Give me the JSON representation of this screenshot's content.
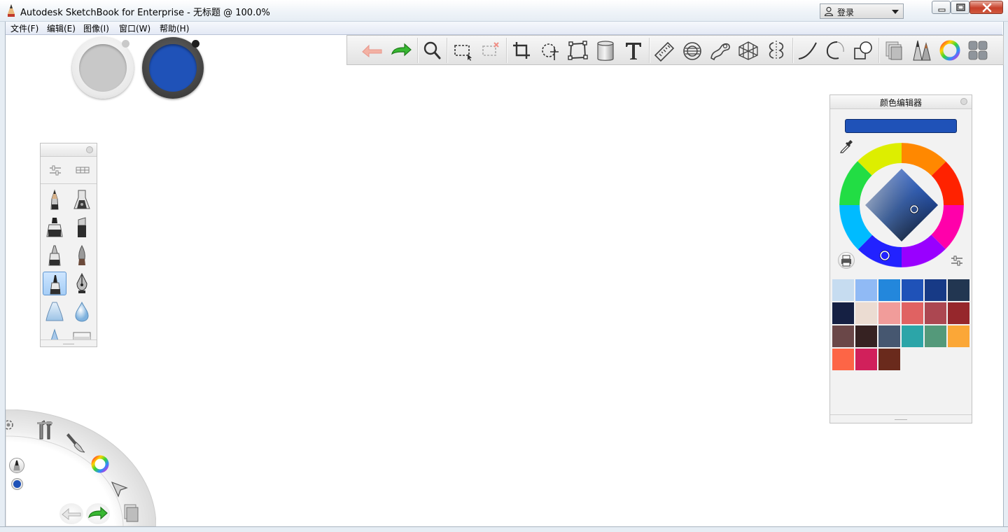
{
  "window": {
    "title": "Autodesk SketchBook for Enterprise - 无标题 @ 100.0%",
    "login_label": "登录"
  },
  "menu": [
    "文件(F)",
    "编辑(E)",
    "图像(I)",
    "窗口(W)",
    "帮助(H)"
  ],
  "colors": {
    "primary": "#1f52b8",
    "secondary": "#c8c8c8"
  },
  "toolbar": {
    "tools": [
      "undo-icon",
      "redo-icon",
      "zoom-icon",
      "select-rect-icon",
      "select-clear-icon",
      "crop-icon",
      "transform-lasso-icon",
      "distort-icon",
      "fill-bucket-icon",
      "text-icon",
      "ruler-icon",
      "ellipse-guide-icon",
      "french-curve-icon",
      "perspective-icon",
      "symmetry-icon",
      "stroke-line-icon",
      "ellipse-stroke-icon",
      "shape-icon",
      "layers-icon",
      "brush-library-icon",
      "color-wheel-icon",
      "tool-menu-icon"
    ]
  },
  "brush_panel": {
    "brushes": [
      "pencil",
      "airbrush",
      "marker",
      "chisel-marker",
      "ballpoint-pen",
      "paint-brush",
      "fine-pen",
      "ink-pen",
      "soft-eraser",
      "water-drop",
      "triangle-tip",
      "flat-eraser"
    ],
    "selected_index": 6
  },
  "color_editor": {
    "title": "颜色编辑器",
    "current_color": "#1f52b8",
    "swatches": [
      "#c6dcf0",
      "#90baf5",
      "#2387dc",
      "#1f52b8",
      "#173a86",
      "#223651",
      "#152043",
      "#ebdcd2",
      "#f19c9a",
      "#e06262",
      "#ac4751",
      "#96272c",
      "#6a4748",
      "#362222",
      "#465770",
      "#2ca5a8",
      "#54997a",
      "#fba737",
      "#fd6546",
      "#d1205b",
      "#6a2a1c"
    ]
  }
}
